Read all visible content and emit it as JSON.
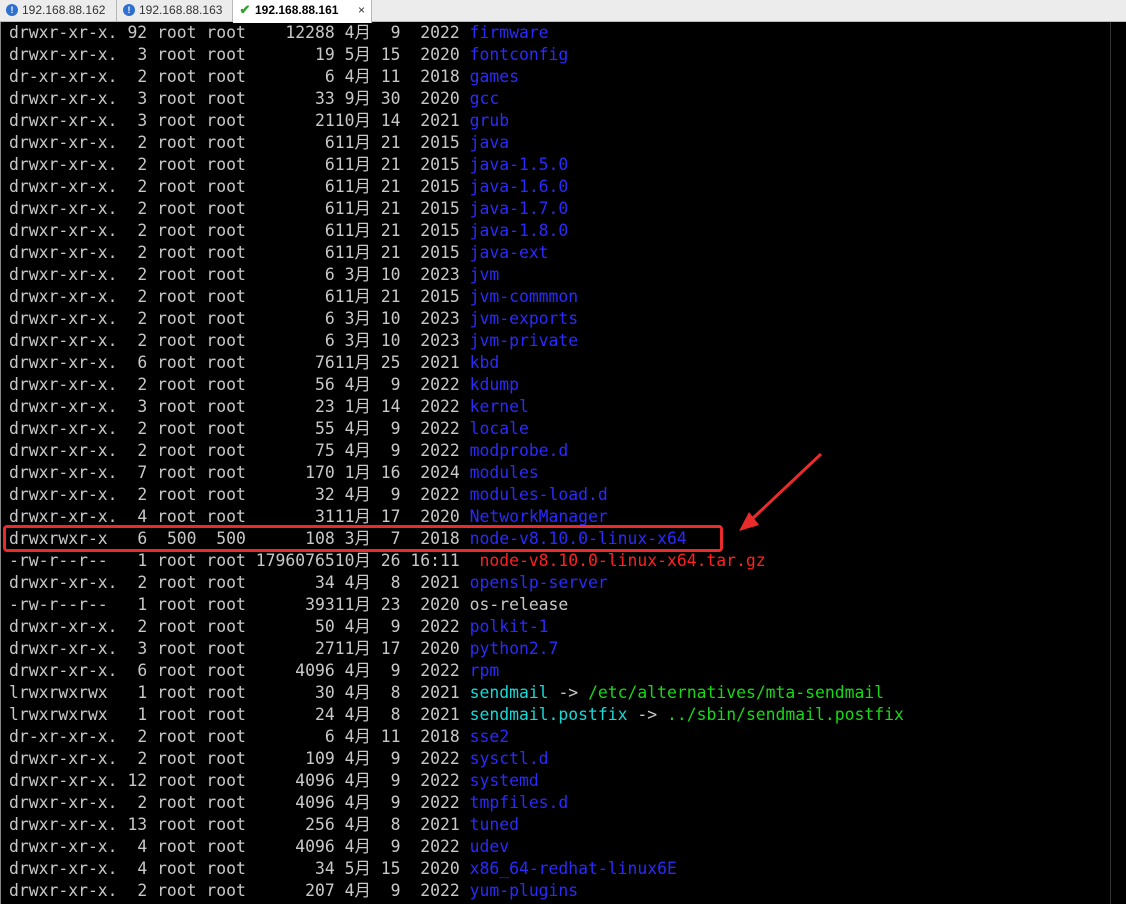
{
  "tabs": [
    {
      "label": "192.168.88.162",
      "icon": "info-icon",
      "active": false
    },
    {
      "label": "192.168.88.163",
      "icon": "info-icon",
      "active": false
    },
    {
      "label": "192.168.88.161",
      "icon": "check-icon",
      "active": true,
      "close": "×"
    }
  ],
  "colors": {
    "directory": "#2a2aff",
    "archive": "#ff2020",
    "symlink": "#18d8d8",
    "symlink_target": "#18d818",
    "highlight_box": "#ea2b2b"
  },
  "listing": [
    {
      "perm": "drwxr-xr-x.",
      "links": "92",
      "user": "root",
      "group": "root",
      "size": "12288",
      "month": "4月",
      "day": "9",
      "time": "2022",
      "name": "firmware",
      "type": "dir"
    },
    {
      "perm": "drwxr-xr-x.",
      "links": "3",
      "user": "root",
      "group": "root",
      "size": "19",
      "month": "5月",
      "day": "15",
      "time": "2020",
      "name": "fontconfig",
      "type": "dir"
    },
    {
      "perm": "dr-xr-xr-x.",
      "links": "2",
      "user": "root",
      "group": "root",
      "size": "6",
      "month": "4月",
      "day": "11",
      "time": "2018",
      "name": "games",
      "type": "dir"
    },
    {
      "perm": "drwxr-xr-x.",
      "links": "3",
      "user": "root",
      "group": "root",
      "size": "33",
      "month": "9月",
      "day": "30",
      "time": "2020",
      "name": "gcc",
      "type": "dir"
    },
    {
      "perm": "drwxr-xr-x.",
      "links": "3",
      "user": "root",
      "group": "root",
      "size": "21",
      "month": "10月",
      "day": "14",
      "time": "2021",
      "name": "grub",
      "type": "dir"
    },
    {
      "perm": "drwxr-xr-x.",
      "links": "2",
      "user": "root",
      "group": "root",
      "size": "6",
      "month": "11月",
      "day": "21",
      "time": "2015",
      "name": "java",
      "type": "dir"
    },
    {
      "perm": "drwxr-xr-x.",
      "links": "2",
      "user": "root",
      "group": "root",
      "size": "6",
      "month": "11月",
      "day": "21",
      "time": "2015",
      "name": "java-1.5.0",
      "type": "dir"
    },
    {
      "perm": "drwxr-xr-x.",
      "links": "2",
      "user": "root",
      "group": "root",
      "size": "6",
      "month": "11月",
      "day": "21",
      "time": "2015",
      "name": "java-1.6.0",
      "type": "dir"
    },
    {
      "perm": "drwxr-xr-x.",
      "links": "2",
      "user": "root",
      "group": "root",
      "size": "6",
      "month": "11月",
      "day": "21",
      "time": "2015",
      "name": "java-1.7.0",
      "type": "dir"
    },
    {
      "perm": "drwxr-xr-x.",
      "links": "2",
      "user": "root",
      "group": "root",
      "size": "6",
      "month": "11月",
      "day": "21",
      "time": "2015",
      "name": "java-1.8.0",
      "type": "dir"
    },
    {
      "perm": "drwxr-xr-x.",
      "links": "2",
      "user": "root",
      "group": "root",
      "size": "6",
      "month": "11月",
      "day": "21",
      "time": "2015",
      "name": "java-ext",
      "type": "dir"
    },
    {
      "perm": "drwxr-xr-x.",
      "links": "2",
      "user": "root",
      "group": "root",
      "size": "6",
      "month": "3月",
      "day": "10",
      "time": "2023",
      "name": "jvm",
      "type": "dir"
    },
    {
      "perm": "drwxr-xr-x.",
      "links": "2",
      "user": "root",
      "group": "root",
      "size": "6",
      "month": "11月",
      "day": "21",
      "time": "2015",
      "name": "jvm-commmon",
      "type": "dir"
    },
    {
      "perm": "drwxr-xr-x.",
      "links": "2",
      "user": "root",
      "group": "root",
      "size": "6",
      "month": "3月",
      "day": "10",
      "time": "2023",
      "name": "jvm-exports",
      "type": "dir"
    },
    {
      "perm": "drwxr-xr-x.",
      "links": "2",
      "user": "root",
      "group": "root",
      "size": "6",
      "month": "3月",
      "day": "10",
      "time": "2023",
      "name": "jvm-private",
      "type": "dir"
    },
    {
      "perm": "drwxr-xr-x.",
      "links": "6",
      "user": "root",
      "group": "root",
      "size": "76",
      "month": "11月",
      "day": "25",
      "time": "2021",
      "name": "kbd",
      "type": "dir"
    },
    {
      "perm": "drwxr-xr-x.",
      "links": "2",
      "user": "root",
      "group": "root",
      "size": "56",
      "month": "4月",
      "day": "9",
      "time": "2022",
      "name": "kdump",
      "type": "dir"
    },
    {
      "perm": "drwxr-xr-x.",
      "links": "3",
      "user": "root",
      "group": "root",
      "size": "23",
      "month": "1月",
      "day": "14",
      "time": "2022",
      "name": "kernel",
      "type": "dir"
    },
    {
      "perm": "drwxr-xr-x.",
      "links": "2",
      "user": "root",
      "group": "root",
      "size": "55",
      "month": "4月",
      "day": "9",
      "time": "2022",
      "name": "locale",
      "type": "dir"
    },
    {
      "perm": "drwxr-xr-x.",
      "links": "2",
      "user": "root",
      "group": "root",
      "size": "75",
      "month": "4月",
      "day": "9",
      "time": "2022",
      "name": "modprobe.d",
      "type": "dir"
    },
    {
      "perm": "drwxr-xr-x.",
      "links": "7",
      "user": "root",
      "group": "root",
      "size": "170",
      "month": "1月",
      "day": "16",
      "time": "2024",
      "name": "modules",
      "type": "dir"
    },
    {
      "perm": "drwxr-xr-x.",
      "links": "2",
      "user": "root",
      "group": "root",
      "size": "32",
      "month": "4月",
      "day": "9",
      "time": "2022",
      "name": "modules-load.d",
      "type": "dir"
    },
    {
      "perm": "drwxr-xr-x.",
      "links": "4",
      "user": "root",
      "group": "root",
      "size": "31",
      "month": "11月",
      "day": "17",
      "time": "2020",
      "name": "NetworkManager",
      "type": "dir"
    },
    {
      "perm": "drwxrwxr-x",
      "links": "6",
      "user": "500",
      "group": "500",
      "size": "108",
      "month": "3月",
      "day": "7",
      "time": "2018",
      "name": "node-v8.10.0-linux-x64",
      "type": "dir"
    },
    {
      "perm": "-rw-r--r--",
      "links": "1",
      "user": "root",
      "group": "root",
      "size": "17960765",
      "month": "10月",
      "day": "26",
      "time": "16:11",
      "name": "node-v8.10.0-linux-x64.tar.gz",
      "type": "tgz"
    },
    {
      "perm": "drwxr-xr-x.",
      "links": "2",
      "user": "root",
      "group": "root",
      "size": "34",
      "month": "4月",
      "day": "8",
      "time": "2021",
      "name": "openslp-server",
      "type": "dir"
    },
    {
      "perm": "-rw-r--r--",
      "links": "1",
      "user": "root",
      "group": "root",
      "size": "393",
      "month": "11月",
      "day": "23",
      "time": "2020",
      "name": "os-release",
      "type": "plain"
    },
    {
      "perm": "drwxr-xr-x.",
      "links": "2",
      "user": "root",
      "group": "root",
      "size": "50",
      "month": "4月",
      "day": "9",
      "time": "2022",
      "name": "polkit-1",
      "type": "dir"
    },
    {
      "perm": "drwxr-xr-x.",
      "links": "3",
      "user": "root",
      "group": "root",
      "size": "27",
      "month": "11月",
      "day": "17",
      "time": "2020",
      "name": "python2.7",
      "type": "dir"
    },
    {
      "perm": "drwxr-xr-x.",
      "links": "6",
      "user": "root",
      "group": "root",
      "size": "4096",
      "month": "4月",
      "day": "9",
      "time": "2022",
      "name": "rpm",
      "type": "dir"
    },
    {
      "perm": "lrwxrwxrwx",
      "links": "1",
      "user": "root",
      "group": "root",
      "size": "30",
      "month": "4月",
      "day": "8",
      "time": "2021",
      "name": "sendmail",
      "type": "lnk",
      "arrow": "->",
      "target": "/etc/alternatives/mta-sendmail"
    },
    {
      "perm": "lrwxrwxrwx",
      "links": "1",
      "user": "root",
      "group": "root",
      "size": "24",
      "month": "4月",
      "day": "8",
      "time": "2021",
      "name": "sendmail.postfix",
      "type": "lnk",
      "arrow": "->",
      "target": "../sbin/sendmail.postfix"
    },
    {
      "perm": "dr-xr-xr-x.",
      "links": "2",
      "user": "root",
      "group": "root",
      "size": "6",
      "month": "4月",
      "day": "11",
      "time": "2018",
      "name": "sse2",
      "type": "dir"
    },
    {
      "perm": "drwxr-xr-x.",
      "links": "2",
      "user": "root",
      "group": "root",
      "size": "109",
      "month": "4月",
      "day": "9",
      "time": "2022",
      "name": "sysctl.d",
      "type": "dir"
    },
    {
      "perm": "drwxr-xr-x.",
      "links": "12",
      "user": "root",
      "group": "root",
      "size": "4096",
      "month": "4月",
      "day": "9",
      "time": "2022",
      "name": "systemd",
      "type": "dir"
    },
    {
      "perm": "drwxr-xr-x.",
      "links": "2",
      "user": "root",
      "group": "root",
      "size": "4096",
      "month": "4月",
      "day": "9",
      "time": "2022",
      "name": "tmpfiles.d",
      "type": "dir"
    },
    {
      "perm": "drwxr-xr-x.",
      "links": "13",
      "user": "root",
      "group": "root",
      "size": "256",
      "month": "4月",
      "day": "8",
      "time": "2021",
      "name": "tuned",
      "type": "dir"
    },
    {
      "perm": "drwxr-xr-x.",
      "links": "4",
      "user": "root",
      "group": "root",
      "size": "4096",
      "month": "4月",
      "day": "9",
      "time": "2022",
      "name": "udev",
      "type": "dir"
    },
    {
      "perm": "drwxr-xr-x.",
      "links": "4",
      "user": "root",
      "group": "root",
      "size": "34",
      "month": "5月",
      "day": "15",
      "time": "2020",
      "name": "x86_64-redhat-linux6E",
      "type": "dir"
    },
    {
      "perm": "drwxr-xr-x.",
      "links": "2",
      "user": "root",
      "group": "root",
      "size": "207",
      "month": "4月",
      "day": "9",
      "time": "2022",
      "name": "yum-plugins",
      "type": "dir"
    }
  ]
}
